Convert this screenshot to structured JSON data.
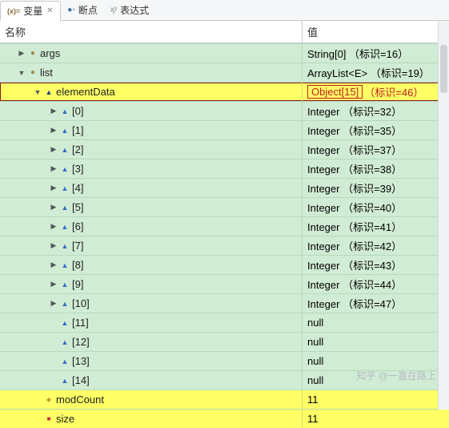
{
  "tabs": {
    "variables": "变量",
    "breakpoints": "断点",
    "expressions": "表达式"
  },
  "header": {
    "name": "名称",
    "value": "值"
  },
  "rows": [
    {
      "indent": 0,
      "expander": "right",
      "icon": "circle",
      "label": "args",
      "value": "String[0]  （标识=16）",
      "bg": "green"
    },
    {
      "indent": 0,
      "expander": "down",
      "icon": "circle",
      "label": "list",
      "value": "ArrayList<E>  （标识=19）",
      "bg": "green"
    },
    {
      "indent": 1,
      "expander": "down",
      "icon": "tri-dkblue",
      "label": "elementData",
      "value_box": "Object[15]",
      "value_tail": "（标识=46）",
      "bg": "yellow",
      "sel": true
    },
    {
      "indent": 2,
      "expander": "right",
      "icon": "tri-blue",
      "label": "[0]",
      "value": "Integer  （标识=32）",
      "bg": "green"
    },
    {
      "indent": 2,
      "expander": "right",
      "icon": "tri-blue",
      "label": "[1]",
      "value": "Integer  （标识=35）",
      "bg": "green"
    },
    {
      "indent": 2,
      "expander": "right",
      "icon": "tri-blue",
      "label": "[2]",
      "value": "Integer  （标识=37）",
      "bg": "green"
    },
    {
      "indent": 2,
      "expander": "right",
      "icon": "tri-blue",
      "label": "[3]",
      "value": "Integer  （标识=38）",
      "bg": "green"
    },
    {
      "indent": 2,
      "expander": "right",
      "icon": "tri-blue",
      "label": "[4]",
      "value": "Integer  （标识=39）",
      "bg": "green"
    },
    {
      "indent": 2,
      "expander": "right",
      "icon": "tri-blue",
      "label": "[5]",
      "value": "Integer  （标识=40）",
      "bg": "green"
    },
    {
      "indent": 2,
      "expander": "right",
      "icon": "tri-blue",
      "label": "[6]",
      "value": "Integer  （标识=41）",
      "bg": "green"
    },
    {
      "indent": 2,
      "expander": "right",
      "icon": "tri-blue",
      "label": "[7]",
      "value": "Integer  （标识=42）",
      "bg": "green"
    },
    {
      "indent": 2,
      "expander": "right",
      "icon": "tri-blue",
      "label": "[8]",
      "value": "Integer  （标识=43）",
      "bg": "green"
    },
    {
      "indent": 2,
      "expander": "right",
      "icon": "tri-blue",
      "label": "[9]",
      "value": "Integer  （标识=44）",
      "bg": "green"
    },
    {
      "indent": 2,
      "expander": "right",
      "icon": "tri-blue",
      "label": "[10]",
      "value": "Integer  （标识=47）",
      "bg": "green"
    },
    {
      "indent": 2,
      "expander": "none",
      "icon": "tri-blue",
      "label": "[11]",
      "value": "null",
      "bg": "green"
    },
    {
      "indent": 2,
      "expander": "none",
      "icon": "tri-blue",
      "label": "[12]",
      "value": "null",
      "bg": "green"
    },
    {
      "indent": 2,
      "expander": "none",
      "icon": "tri-blue",
      "label": "[13]",
      "value": "null",
      "bg": "green"
    },
    {
      "indent": 2,
      "expander": "none",
      "icon": "tri-blue",
      "label": "[14]",
      "value": "null",
      "bg": "green"
    },
    {
      "indent": 1,
      "expander": "none",
      "icon": "diamond",
      "label": "modCount",
      "value": "11",
      "bg": "yellow"
    },
    {
      "indent": 1,
      "expander": "none",
      "icon": "square",
      "label": "size",
      "value": "11",
      "bg": "yellow"
    }
  ],
  "watermark": "知乎 @一直在路上"
}
